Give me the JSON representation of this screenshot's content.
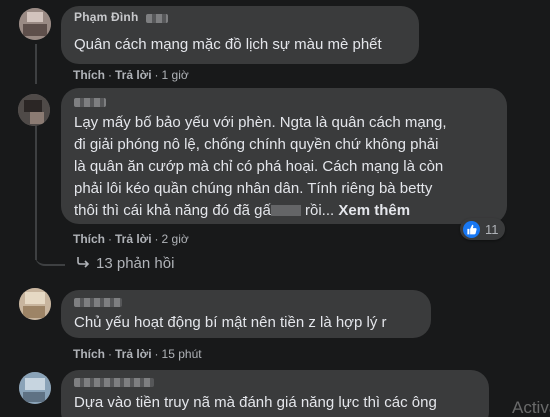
{
  "comments": [
    {
      "author": "Phạm Đình",
      "lines": [
        "Quân cách mạng mặc đồ lịch sự màu mè phết"
      ],
      "actions": {
        "like": "Thích",
        "reply": "Trả lời",
        "time": "1 giờ"
      }
    },
    {
      "author": "",
      "lines": [
        "Lạy mấy bố bảo yếu với phèn. Ngta là quân cách mạng,",
        "đi giải phóng nô lệ, chống chính quyền chứ không phải",
        "là quân ăn cướp mà chỉ có phá hoại. Cách mạng là còn",
        "phải lôi kéo quần chúng nhân dân. Tính riêng bà betty"
      ],
      "last_line_start": "thôi thì cái khả năng đó đã gấ",
      "last_line_end": " rồi...",
      "see_more": "Xem thêm",
      "actions": {
        "like": "Thích",
        "reply": "Trả lời",
        "time": "2 giờ"
      },
      "reaction_count": "11",
      "replies_label": "13 phản hồi"
    },
    {
      "author": "",
      "lines": [
        "Chủ yếu hoạt động bí mật nên tiền z là hợp lý r"
      ],
      "actions": {
        "like": "Thích",
        "reply": "Trả lời",
        "time": "15 phút"
      }
    },
    {
      "author": "",
      "lines": [
        "Dựa vào tiền truy nã mà đánh giá năng lực thì các ông"
      ]
    }
  ],
  "separator": "·",
  "watermark": "Activat",
  "icons": {
    "reply_arrow": "reply-arrow-icon",
    "like": "thumbs-up-icon"
  },
  "colors": {
    "background": "#18191a",
    "bubble": "#3a3b3c",
    "like": "#1877f2"
  }
}
